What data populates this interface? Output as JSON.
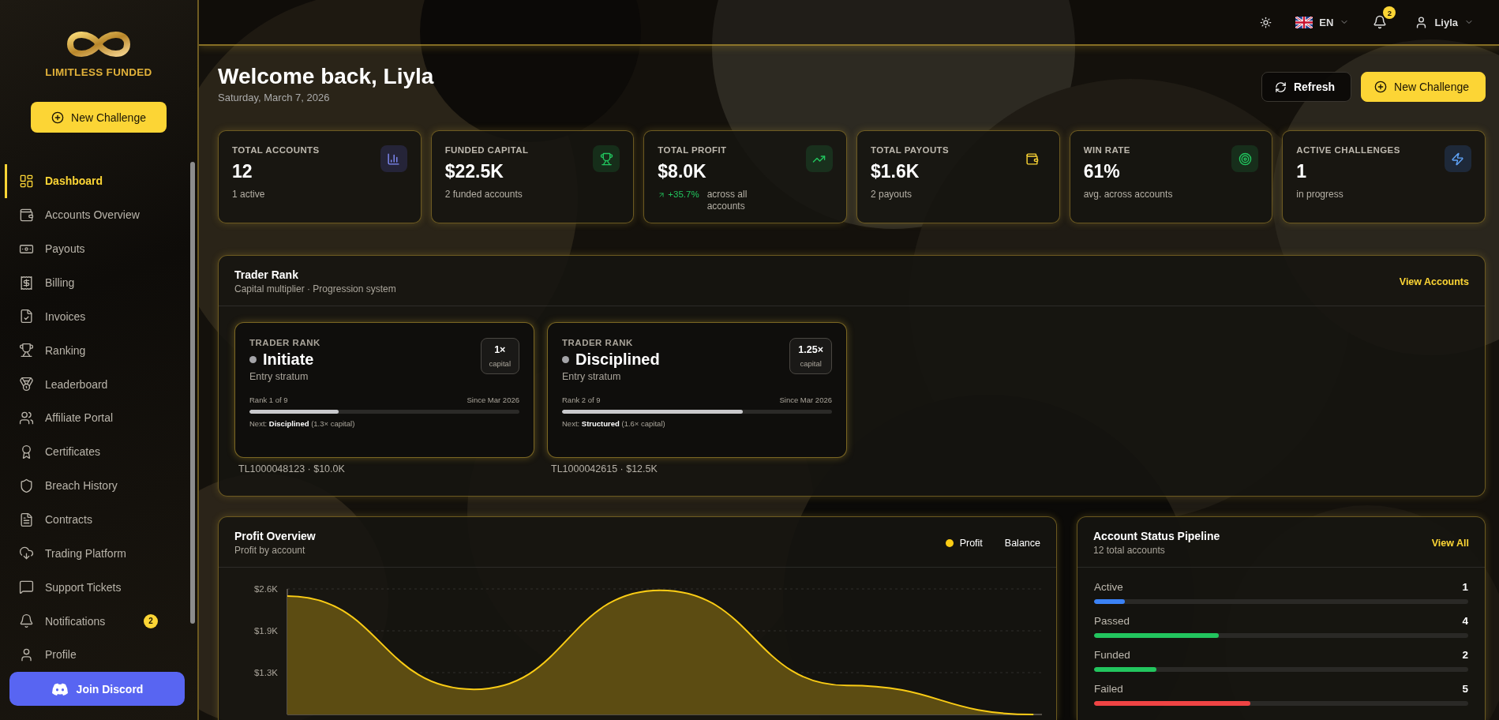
{
  "brand": {
    "name": "LIMITLESS FUNDED"
  },
  "sidebar": {
    "cta": "New Challenge",
    "items": [
      {
        "label": "Dashboard",
        "selected": true
      },
      {
        "label": "Accounts Overview",
        "selected": false
      },
      {
        "label": "Payouts",
        "selected": false
      },
      {
        "label": "Billing",
        "selected": false
      },
      {
        "label": "Invoices",
        "selected": false
      },
      {
        "label": "Ranking",
        "selected": false
      },
      {
        "label": "Leaderboard",
        "selected": false
      },
      {
        "label": "Affiliate Portal",
        "selected": false
      },
      {
        "label": "Certificates",
        "selected": false
      },
      {
        "label": "Breach History",
        "selected": false
      },
      {
        "label": "Contracts",
        "selected": false
      },
      {
        "label": "Trading Platform",
        "selected": false
      },
      {
        "label": "Support Tickets",
        "selected": false
      },
      {
        "label": "Notifications",
        "selected": false,
        "badge": "2"
      },
      {
        "label": "Profile",
        "selected": false
      }
    ],
    "discord": "Join Discord"
  },
  "topbar": {
    "language": "EN",
    "notifications": "2",
    "user": "Liyla"
  },
  "header": {
    "title": "Welcome back, Liyla",
    "date": "Saturday, March 7, 2026",
    "actions": [
      {
        "label": "Refresh",
        "kind": "secondary"
      },
      {
        "label": "New Challenge",
        "kind": "primary"
      }
    ]
  },
  "stats": [
    {
      "label": "TOTAL ACCOUNTS",
      "value": "12",
      "sub": "1 active"
    },
    {
      "label": "FUNDED CAPITAL",
      "value": "$22.5K",
      "sub": "2 funded accounts"
    },
    {
      "label": "TOTAL PROFIT",
      "value": "$8.0K",
      "change": "+35.7%",
      "sub": "across all accounts"
    },
    {
      "label": "TOTAL PAYOUTS",
      "value": "$1.6K",
      "sub": "2 payouts"
    },
    {
      "label": "WIN RATE",
      "value": "61%",
      "sub": "avg. across accounts"
    },
    {
      "label": "ACTIVE CHALLENGES",
      "value": "1",
      "sub": "in progress"
    }
  ],
  "trader_rank": {
    "title": "Trader Rank",
    "subtitle": "Capital multiplier · Progression system",
    "link": "View Accounts",
    "cards": [
      {
        "eyebrow": "TRADER RANK",
        "rank": "Initiate",
        "stratum": "Entry stratum",
        "multiplier": "1×",
        "multiplier_unit": "capital",
        "position": "Rank 1 of 9",
        "since": "Since Mar 2026",
        "level": 0.33,
        "next": "Next: **Disciplined** (1.3× capital)",
        "account": "TL1000048123 · $10.0K"
      },
      {
        "eyebrow": "TRADER RANK",
        "rank": "Disciplined",
        "stratum": "Entry stratum",
        "multiplier": "1.25×",
        "multiplier_unit": "capital",
        "position": "Rank 2 of 9",
        "since": "Since Mar 2026",
        "level": 0.67,
        "next": "Next: **Structured** (1.6× capital)",
        "account": "TL1000042615 · $12.5K"
      }
    ]
  },
  "profit_overview": {
    "title": "Profit Overview",
    "subtitle": "Profit by account",
    "legend": [
      {
        "label": "Balance",
        "selected": false
      }
    ],
    "chart_data": {
      "type": "area",
      "ylim": [
        650,
        2600
      ],
      "yticks": [
        {
          "value": 2600,
          "label": "$2.6K"
        },
        {
          "value": 1950,
          "label": "$1.9K"
        },
        {
          "value": 1300,
          "label": "$1.3K"
        }
      ],
      "series": [
        {
          "name": "Profit",
          "color": "#facc15",
          "values": [
            2490,
            1040,
            2580,
            1100,
            650
          ]
        }
      ]
    }
  },
  "pipeline": {
    "title": "Account Status Pipeline",
    "subtitle": "12 total accounts",
    "link": "View All",
    "rows": [
      {
        "label": "Active",
        "count": "1",
        "level": 0.083,
        "color": "#3b82f6"
      },
      {
        "label": "Passed",
        "count": "4",
        "level": 0.333,
        "color": "#22c55e"
      },
      {
        "label": "Funded",
        "count": "2",
        "level": 0.167,
        "color": "#22c55e"
      },
      {
        "label": "Failed",
        "count": "5",
        "level": 0.417,
        "color": "#ef4444"
      }
    ]
  }
}
